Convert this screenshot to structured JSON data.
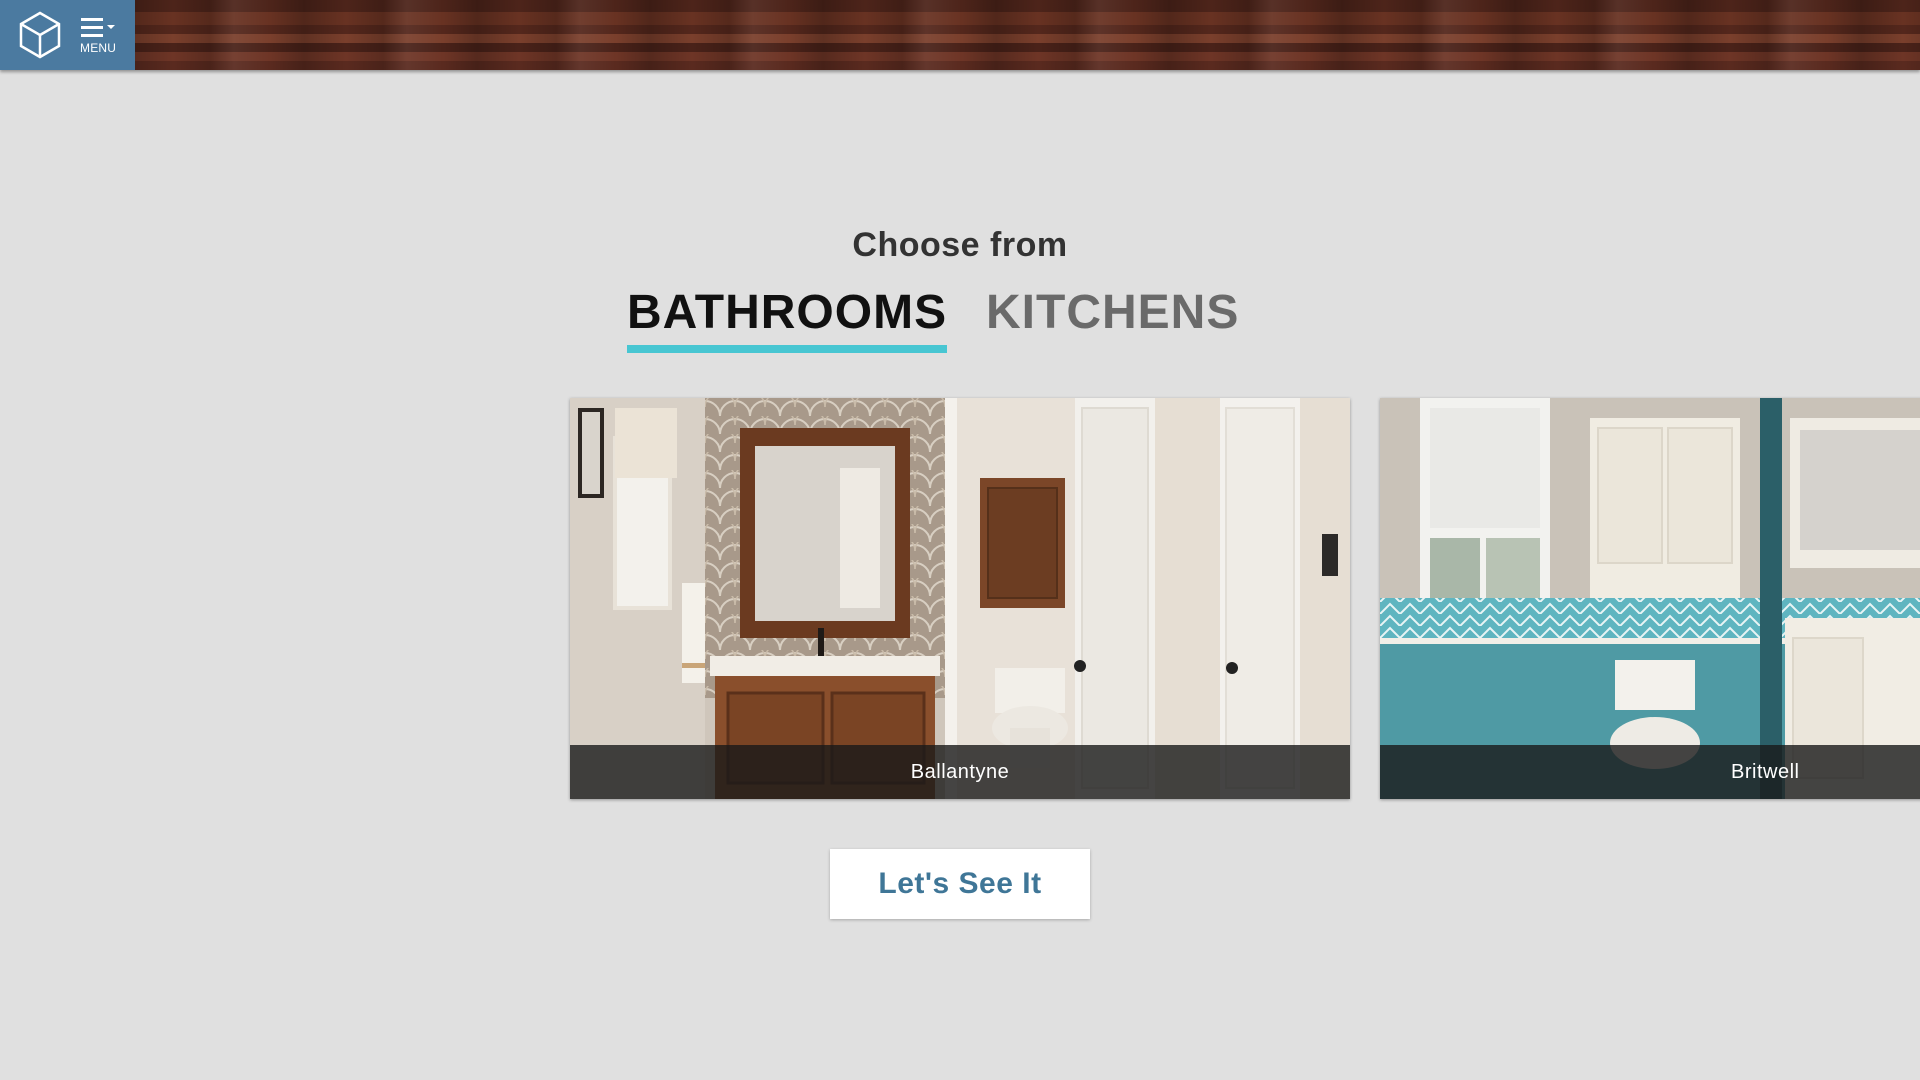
{
  "header": {
    "menu_label": "MENU",
    "logo_icon": "cube-logo-icon",
    "menu_icon": "hamburger-dropdown-icon",
    "accent_color": "#4b7aa0"
  },
  "main": {
    "heading": "Choose from",
    "tabs": [
      {
        "label": "BATHROOMS",
        "active": true
      },
      {
        "label": "KITCHENS",
        "active": false
      }
    ],
    "active_tab_underline_color": "#48c6d2",
    "cards": [
      {
        "caption": "Ballantyne"
      },
      {
        "caption": "Britwell"
      }
    ],
    "cta_label": "Let's See It"
  }
}
